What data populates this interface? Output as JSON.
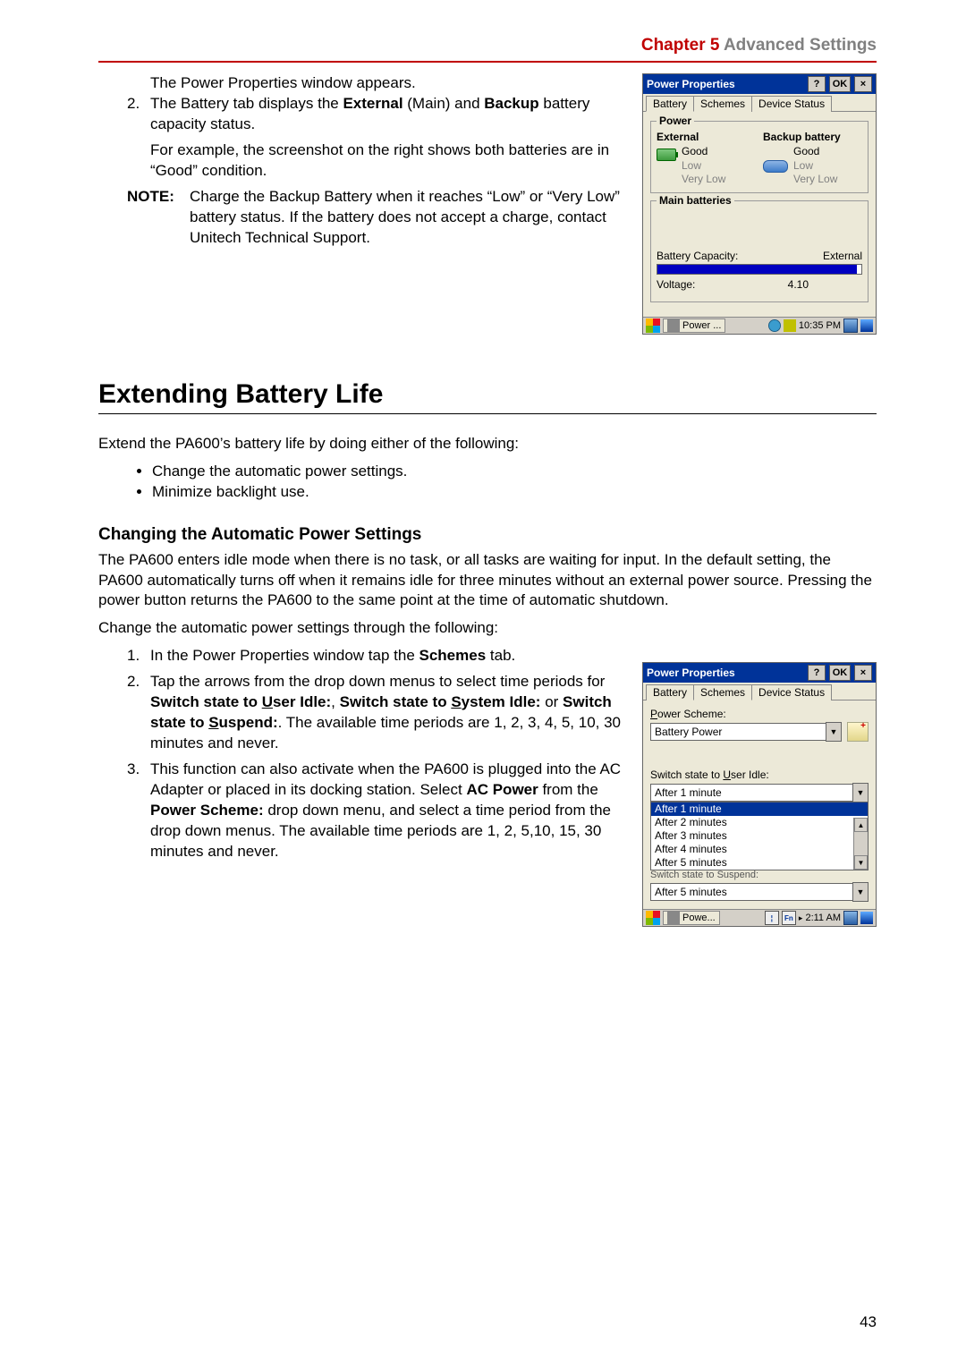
{
  "header": {
    "chapter_num": "Chapter 5",
    "chapter_name": "Advanced Settings"
  },
  "top_block": {
    "intro_line": "The Power Properties window appears.",
    "li2_num": "2.",
    "li2_p1_a": "The Battery tab displays the ",
    "li2_p1_b": "External",
    "li2_p1_c": " (Main) and ",
    "li2_p1_d": "Backup",
    "li2_p1_e": " battery capacity status.",
    "li2_p2": "For example, the screenshot on the right shows both batteries are in “Good” condition.",
    "note_label": "NOTE:",
    "note_text": "Charge the Backup Battery when it reaches “Low” or “Very Low” battery status. If the battery does not accept a charge, contact Unitech Technical Support."
  },
  "fig1": {
    "title": "Power Properties",
    "help_btn": "?",
    "ok_btn": "OK",
    "close_btn": "×",
    "tab_battery": "Battery",
    "tab_schemes": "Schemes",
    "tab_device": "Device Status",
    "power_legend": "Power",
    "external_head": "External",
    "backup_head": "Backup battery",
    "good": "Good",
    "low": "Low",
    "verylow": "Very Low",
    "main_legend": "Main batteries",
    "cap_label": "Battery Capacity:",
    "cap_value": "External",
    "volt_label": "Voltage:",
    "volt_value": "4.10",
    "task_label": "Power ...",
    "task_time": "10:35 PM"
  },
  "section": {
    "title": "Extending Battery Life",
    "intro": "Extend the PA600’s battery life by doing either of the following:",
    "bullet1": "Change the automatic power settings.",
    "bullet2": "Minimize backlight use.",
    "subtitle": "Changing the Automatic Power Settings",
    "para1": "The PA600 enters idle mode when there is no task, or all tasks are waiting for input. In the default setting, the PA600 automatically turns off when it remains idle for three minutes without an external power source. Pressing the power button returns the PA600 to the same point at the time of automatic shutdown.",
    "para2": "Change the automatic power settings through the following:"
  },
  "steps": {
    "s1_num": "1.",
    "s1_a": "In the Power Properties window tap the ",
    "s1_b": "Schemes",
    "s1_c": " tab.",
    "s2_num": "2.",
    "s2_a": "Tap the arrows from the drop down menus to select time periods for ",
    "s2_b": "Switch state to ",
    "s2_b_u": "U",
    "s2_b2": "ser Idle:",
    "s2_c": ", ",
    "s2_d": "Switch state to ",
    "s2_d_u": "S",
    "s2_d2": "ystem Idle:",
    "s2_e": " or ",
    "s2_f": "Switch state to ",
    "s2_f_u": "S",
    "s2_f2": "uspend:",
    "s2_g": ". The available time periods are 1, 2, 3, 4, 5, 10, 30 minutes and never.",
    "s3_num": "3.",
    "s3_a": "This function can also activate when the PA600 is plugged into the AC Adapter or placed in its docking station. Select ",
    "s3_b": "AC Power",
    "s3_c": " from the ",
    "s3_d": "Power Scheme:",
    "s3_e": " drop down menu, and select a time period from the drop down menus. The available time periods are 1, 2, 5,10, 15, 30 minutes and never."
  },
  "fig2": {
    "title": "Power Properties",
    "help_btn": "?",
    "ok_btn": "OK",
    "close_btn": "×",
    "tab_battery": "Battery",
    "tab_schemes": "Schemes",
    "tab_device": "Device Status",
    "scheme_label_a": "P",
    "scheme_label_b": "ower Scheme:",
    "scheme_value": "Battery Power",
    "switch_label_a": "Switch state to ",
    "switch_label_u": "U",
    "switch_label_b": "ser Idle:",
    "idle_value": "After 1 minute",
    "dd_items": [
      "After 1 minute",
      "After 2 minutes",
      "After 3 minutes",
      "After 4 minutes",
      "After 5 minutes"
    ],
    "below_text": "Switch state to Suspend:",
    "suspend_value": "After 5 minutes",
    "task_label": "Powe...",
    "kb_fn": "Fn",
    "kb_sym": "¦",
    "task_time": "2:11 AM"
  },
  "page_number": "43"
}
